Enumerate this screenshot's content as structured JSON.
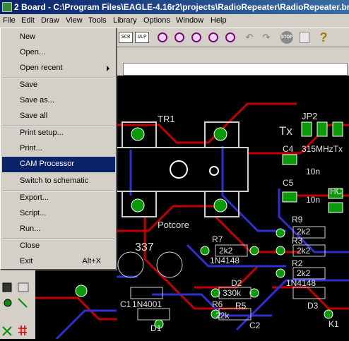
{
  "window": {
    "title": "2 Board - C:\\Program Files\\EAGLE-4.16r2\\projects\\RadioRepeater\\RadioRepeater.brd"
  },
  "menubar": [
    "File",
    "Edit",
    "Draw",
    "View",
    "Tools",
    "Library",
    "Options",
    "Window",
    "Help"
  ],
  "toolbar": {
    "script_label": "SCR",
    "ulp_label": "ULP",
    "stop_label": "STOP",
    "help_glyph": "?"
  },
  "file_menu": {
    "items": [
      {
        "label": "New"
      },
      {
        "label": "Open..."
      },
      {
        "label": "Open recent"
      },
      {
        "label": "Save"
      },
      {
        "label": "Save as..."
      },
      {
        "label": "Save all"
      },
      {
        "label": "Print setup..."
      },
      {
        "label": "Print..."
      },
      {
        "label": "CAM Processor"
      },
      {
        "label": "Switch to schematic"
      },
      {
        "label": "Export..."
      },
      {
        "label": "Script..."
      },
      {
        "label": "Run..."
      },
      {
        "label": "Close"
      },
      {
        "label": "Exit",
        "shortcut": "Alt+X"
      }
    ],
    "selected": "CAM Processor"
  },
  "board": {
    "labels": [
      "TR1",
      "Potcore",
      "337",
      "JP2",
      "Tx",
      "C4",
      "315MHzTx",
      "10n",
      "C5",
      "10n",
      "HC",
      "R9",
      "2k2",
      "R3",
      "2k2",
      "R7",
      "2k2",
      "1N4148",
      "R2",
      "2k2",
      "D2",
      "330k",
      "1N4148",
      "R6",
      "22k",
      "R5",
      "D3",
      "C1",
      "1N4001",
      "D1",
      "C2",
      "K1"
    ]
  }
}
